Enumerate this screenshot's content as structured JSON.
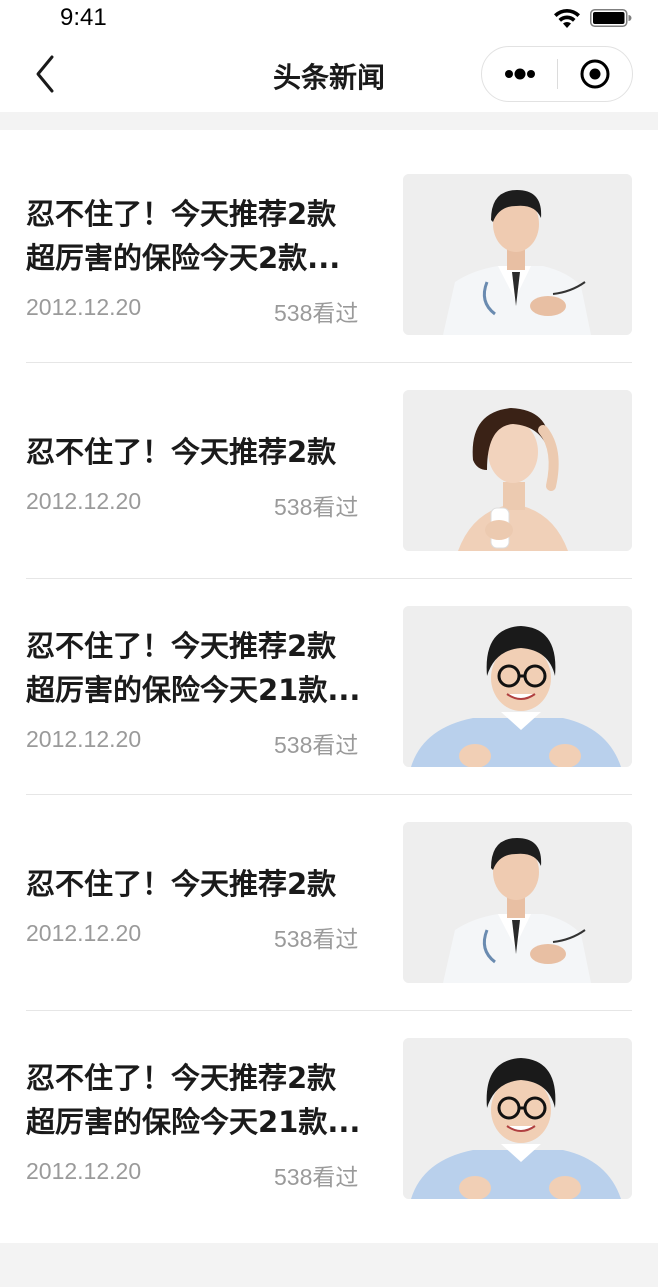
{
  "status_bar": {
    "time": "9:41",
    "icons": [
      "wifi-icon",
      "battery-icon"
    ]
  },
  "nav": {
    "title": "头条新闻",
    "back_icon": "chevron-left-icon",
    "capsule_icons": [
      "more-dots-icon",
      "close-target-icon"
    ]
  },
  "articles": [
    {
      "title_lines": [
        "忍不住了！今天推荐2款",
        "超厉害的保险今天2款..."
      ],
      "date": "2012.12.20",
      "views": "538看过",
      "image": "doctor-man-photo"
    },
    {
      "title_lines": [
        "忍不住了！今天推荐2款"
      ],
      "date": "2012.12.20",
      "views": "538看过",
      "image": "woman-milk-photo"
    },
    {
      "title_lines": [
        "忍不住了！今天推荐2款",
        "超厉害的保险今天21款..."
      ],
      "date": "2012.12.20",
      "views": "538看过",
      "image": "boy-glasses-thumbs-up-photo"
    },
    {
      "title_lines": [
        "忍不住了！今天推荐2款"
      ],
      "date": "2012.12.20",
      "views": "538看过",
      "image": "doctor-man-photo"
    },
    {
      "title_lines": [
        "忍不住了！今天推荐2款",
        "超厉害的保险今天21款..."
      ],
      "date": "2012.12.20",
      "views": "538看过",
      "image": "boy-glasses-thumbs-up-photo"
    }
  ],
  "colors": {
    "page_bg": "#f3f3f3",
    "card_bg": "#ffffff",
    "title_text": "#1a1a1a",
    "meta_text": "#9a9a9a",
    "divider": "#e6e6e6"
  }
}
